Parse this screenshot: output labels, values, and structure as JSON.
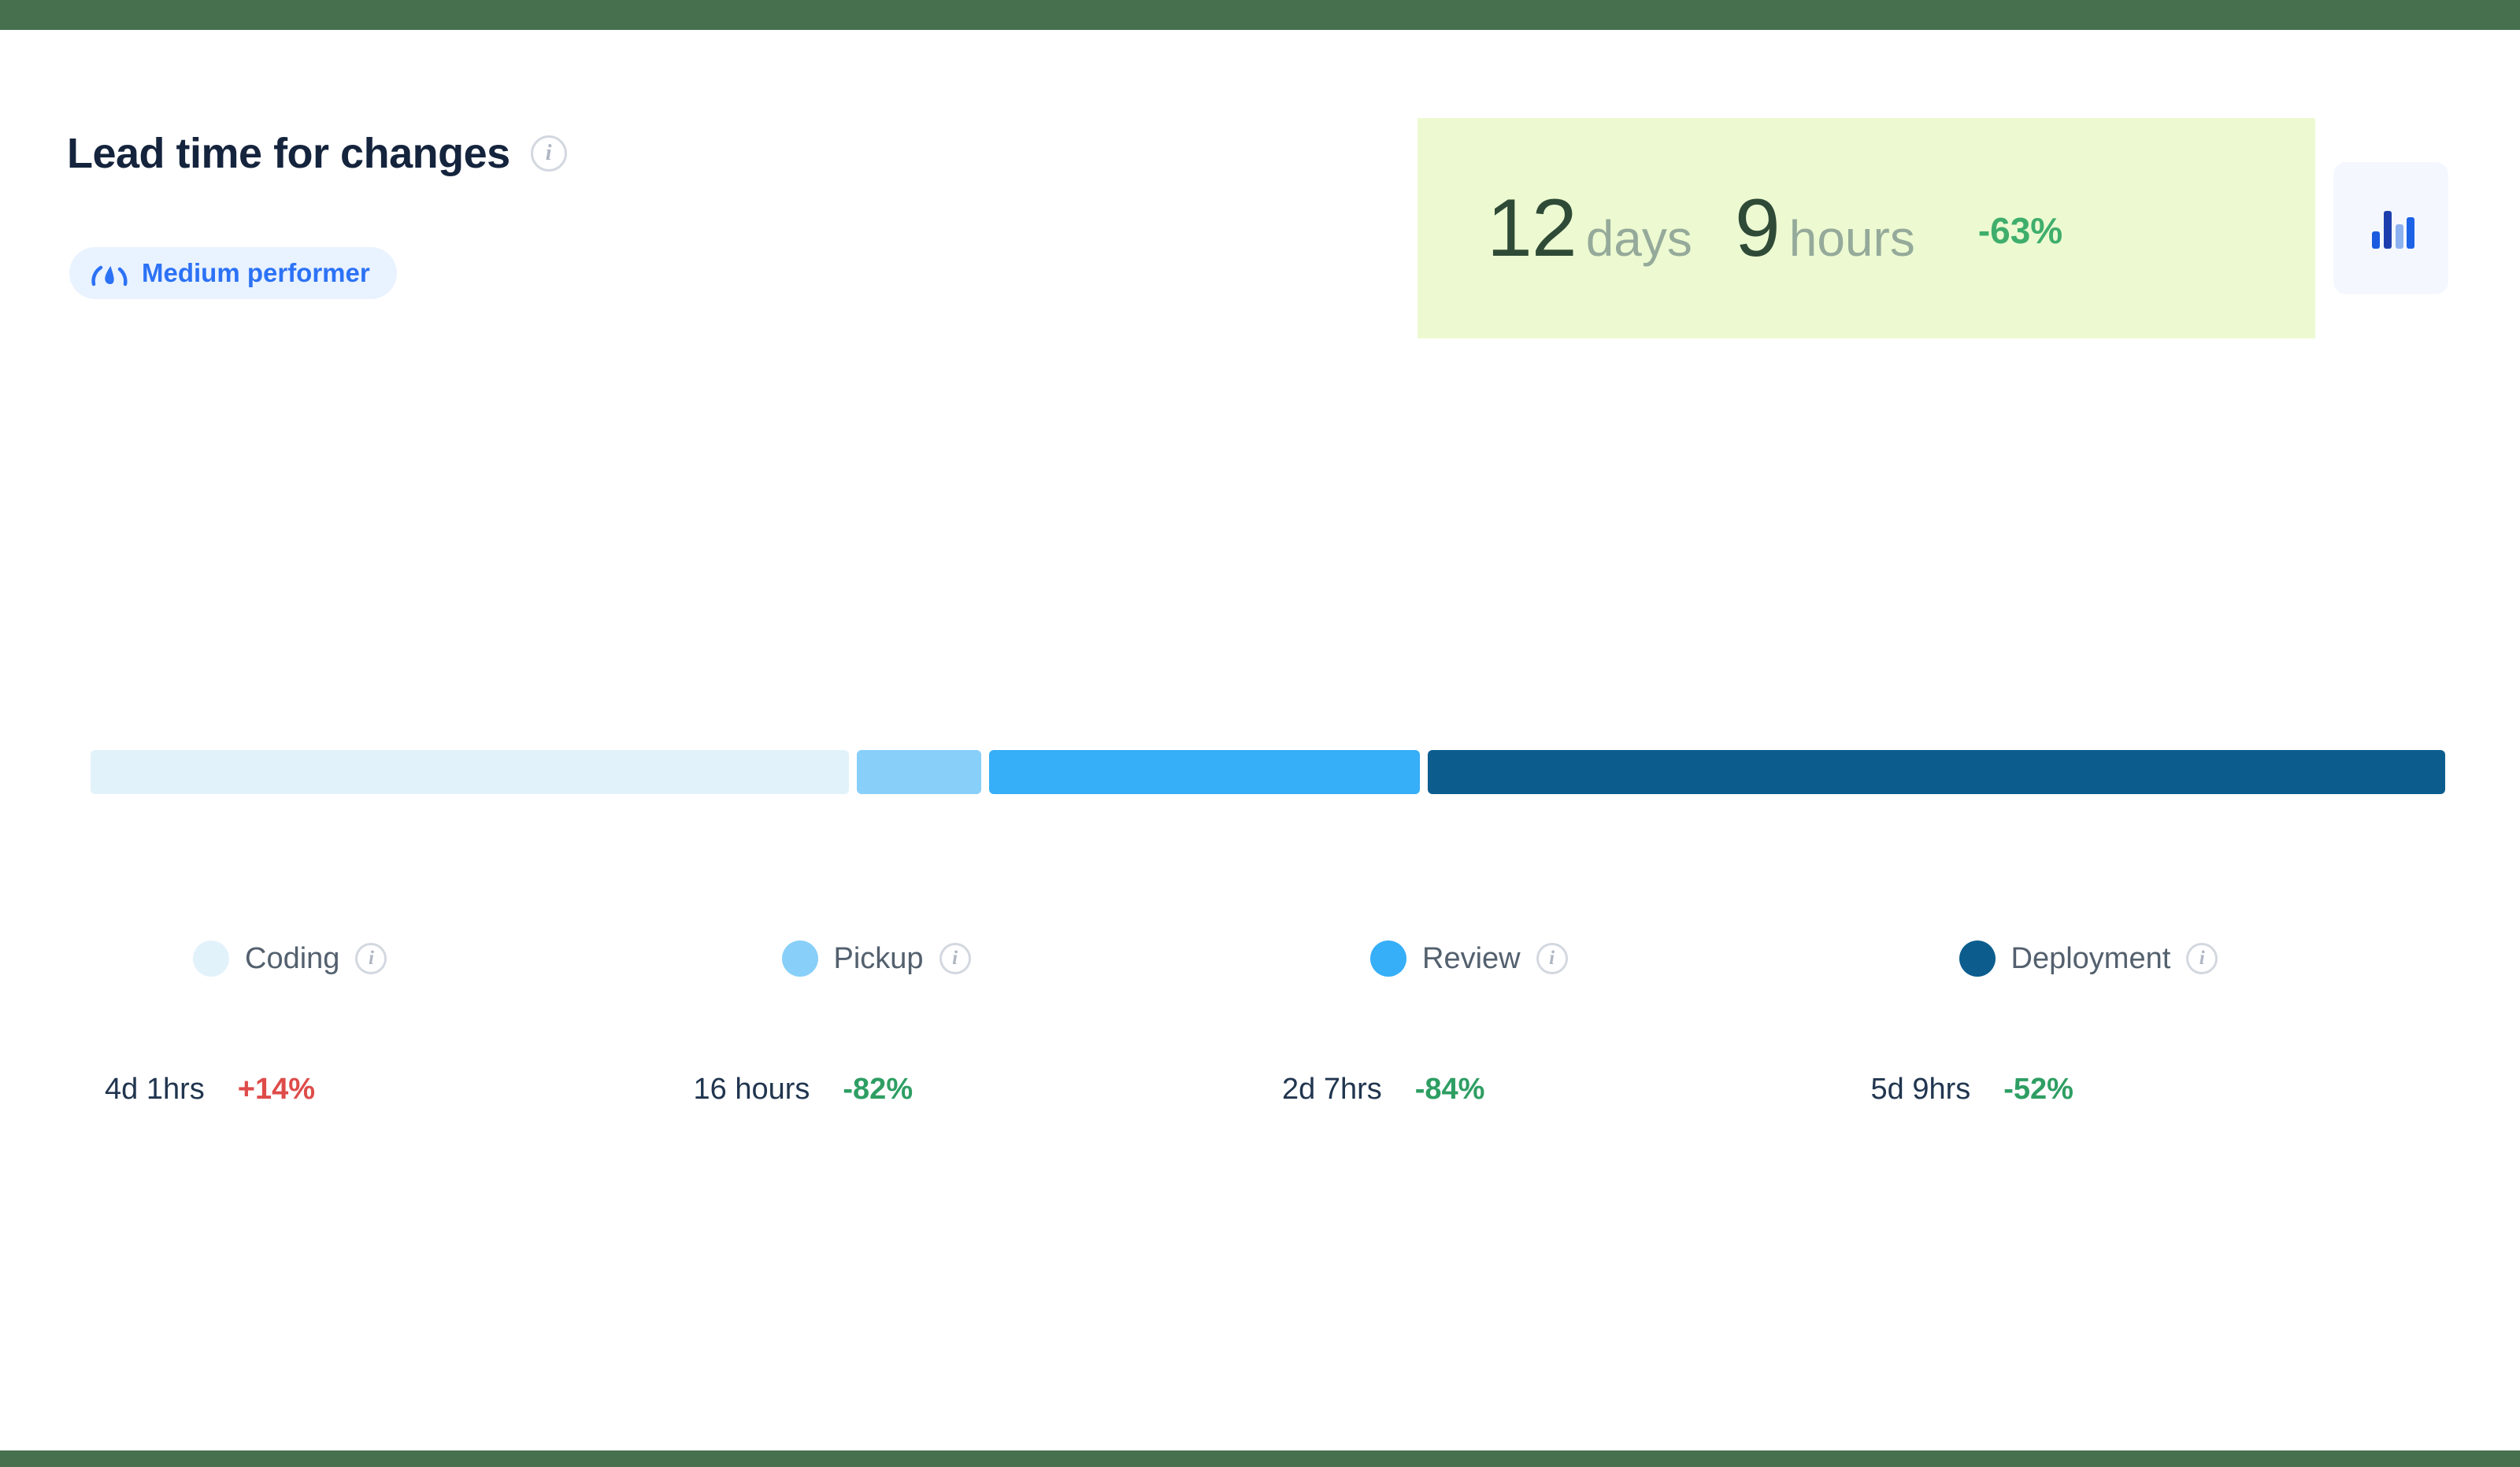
{
  "header": {
    "title": "Lead time for changes",
    "title_info_icon": "info-icon",
    "performer_badge": {
      "label": "Medium performer",
      "icon": "gauge-icon",
      "bg_color": "#E9F2FF",
      "text_color": "#2C72F6"
    }
  },
  "metric": {
    "days_value": "12",
    "days_unit": "days",
    "hours_value": "9",
    "hours_unit": "hours",
    "delta": "-63%",
    "delta_color": "#3FAE6C",
    "bg_color": "#EDFAD1",
    "value_color": "#2F4B37",
    "unit_color": "#95AA9A"
  },
  "chart_button": {
    "icon": "bar-chart-icon",
    "bg_color": "#F4F8FE",
    "bar_colors": [
      "#1A5BE0",
      "#1D3FAE",
      "#8CB1F0",
      "#1D63E8"
    ]
  },
  "chart_data": {
    "type": "bar",
    "title": "Lead time for changes",
    "subtitle": "Medium performer",
    "total_label": "12 days 9 hours",
    "total_delta": "-63%",
    "orientation": "horizontal-stacked",
    "categories": [
      "Coding",
      "Pickup",
      "Review",
      "Deployment"
    ],
    "values_label": [
      "4d 1hrs",
      "16 hours",
      "2d 7hrs",
      "5d 9hrs"
    ],
    "values_hours": [
      97,
      16,
      55,
      129
    ],
    "widths_pct": [
      32.2,
      5.3,
      18.3,
      43.2
    ],
    "deltas": [
      "+14%",
      "-82%",
      "-84%",
      "-52%"
    ],
    "delta_colors": [
      "#DE4C4A",
      "#2E9E63",
      "#2E9E63",
      "#2E9E63"
    ],
    "colors": [
      "#E2F2FB",
      "#88CFF9",
      "#36AEF8",
      "#0C5D8E"
    ],
    "legend_position": "bottom",
    "grid": false,
    "xlabel": "",
    "ylabel": ""
  },
  "segments": [
    {
      "name": "Coding",
      "color": "#E2F2FB",
      "width_pct": 32.2,
      "time": "4d 1hrs",
      "delta": "+14%",
      "delta_color": "#DE4C4A",
      "info_icon": "info-icon"
    },
    {
      "name": "Pickup",
      "color": "#88CFF9",
      "width_pct": 5.3,
      "time": "16 hours",
      "delta": "-82%",
      "delta_color": "#2E9E63",
      "info_icon": "info-icon"
    },
    {
      "name": "Review",
      "color": "#36AEF8",
      "width_pct": 18.3,
      "time": "2d 7hrs",
      "delta": "-84%",
      "delta_color": "#2E9E63",
      "info_icon": "info-icon"
    },
    {
      "name": "Deployment",
      "color": "#0C5D8E",
      "width_pct": 43.2,
      "time": "5d 9hrs",
      "delta": "-52%",
      "delta_color": "#2E9E63",
      "info_icon": "info-icon"
    }
  ],
  "theme": {
    "frame_color": "#46704E",
    "card_bg": "#FFFFFF"
  }
}
